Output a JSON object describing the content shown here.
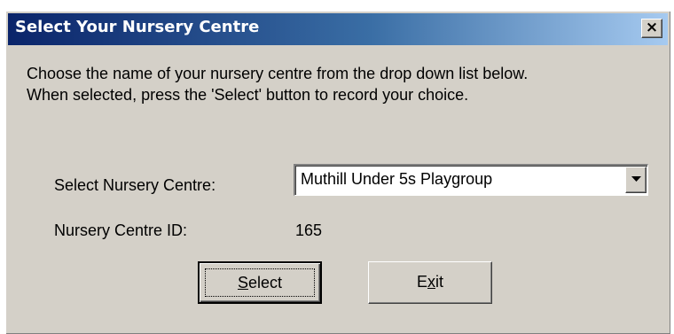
{
  "window": {
    "title": "Select Your Nursery Centre",
    "close_icon": "close-icon",
    "close_glyph": "×"
  },
  "instructions": {
    "line1": "Choose the name of your nursery centre from the drop down list below.",
    "line2": "When selected, press the 'Select' button to record your choice."
  },
  "form": {
    "nursery_label": "Select Nursery Centre:",
    "nursery_selected": "Muthill Under 5s Playgroup",
    "id_label": "Nursery Centre ID:",
    "id_value": "165"
  },
  "buttons": {
    "select": {
      "prefix": "",
      "mnemonic": "S",
      "rest": "elect"
    },
    "exit": {
      "prefix": "E",
      "mnemonic": "x",
      "rest": "it"
    }
  },
  "colors": {
    "titlebar_start": "#0a246a",
    "titlebar_end": "#a6caf0",
    "face": "#d4d0c8"
  }
}
